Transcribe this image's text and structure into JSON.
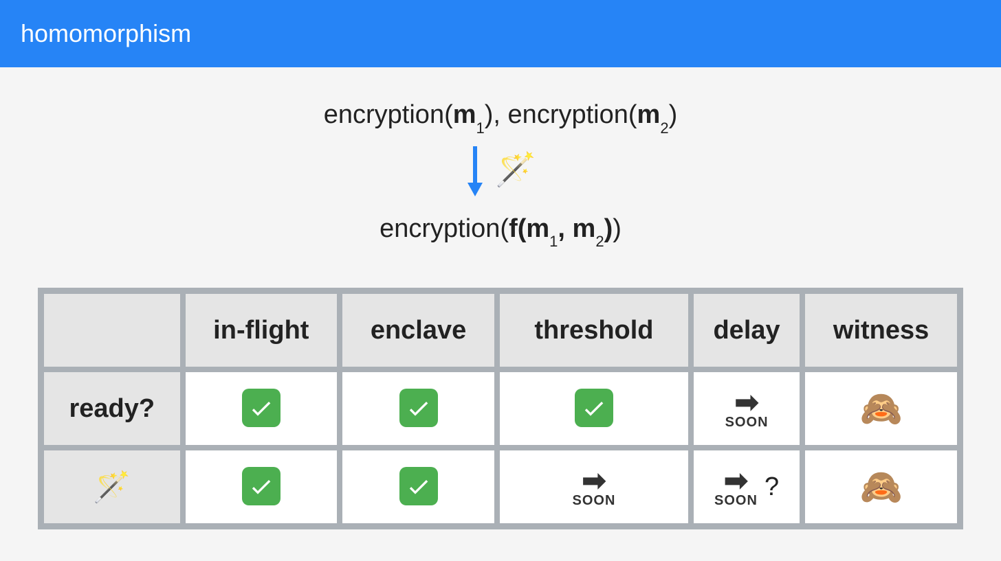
{
  "header": {
    "title": "homomorphism"
  },
  "formula": {
    "prefix": "encryption(",
    "m": "m",
    "sub1": "1",
    "sub2": "2",
    "sep": "), encryption(",
    "close": ")",
    "result_prefix": "encryption(",
    "f": "f(",
    "comma": ", ",
    "fclose": "))"
  },
  "icons": {
    "wand": "🪄",
    "check": "check",
    "soon_label": "SOON",
    "monkey": "🙈",
    "question": "?"
  },
  "table": {
    "columns": [
      "",
      "in-flight",
      "enclave",
      "threshold",
      "delay",
      "witness"
    ],
    "rows": [
      {
        "label": "ready?",
        "label_type": "text",
        "cells": [
          "check",
          "check",
          "check",
          "soon",
          "monkey"
        ]
      },
      {
        "label": "wand",
        "label_type": "icon",
        "cells": [
          "check",
          "check",
          "soon",
          "soon_q",
          "monkey"
        ]
      }
    ]
  }
}
